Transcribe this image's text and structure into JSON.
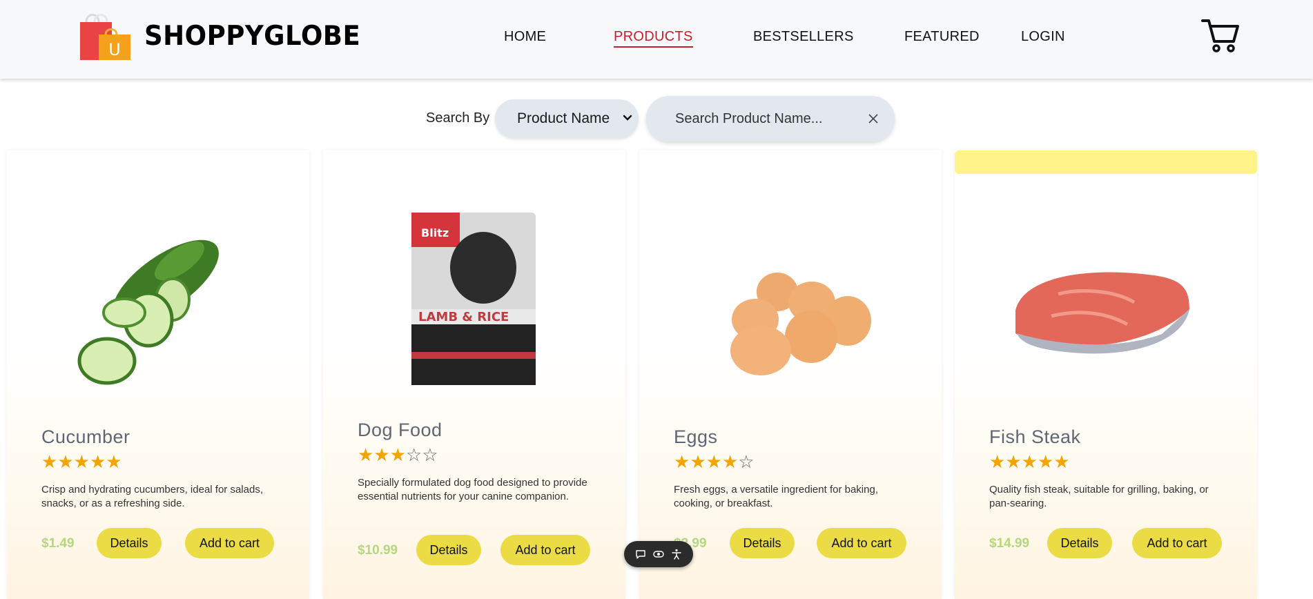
{
  "brand": {
    "name": "SHOPPYGLOBE"
  },
  "nav": {
    "items": [
      "HOME",
      "PRODUCTS",
      "BESTSELLERS",
      "FEATURED",
      "LOGIN"
    ],
    "active": "PRODUCTS"
  },
  "search": {
    "label": "Search By",
    "select_value": "Product Name",
    "placeholder": "Search Product Name..."
  },
  "products": [
    {
      "name": "Cucumber",
      "rating": 5,
      "stars": "★★★★★",
      "description": "Crisp and hydrating cucumbers, ideal for salads, snacks, or as a refreshing side.",
      "price": "$1.49"
    },
    {
      "name": "Dog Food",
      "rating": 3,
      "stars": "★★★☆☆",
      "description": "Specially formulated dog food designed to provide essential nutrients for your canine companion.",
      "price": "$10.99"
    },
    {
      "name": "Eggs",
      "rating": 4,
      "stars": "★★★★☆",
      "description": "Fresh eggs, a versatile ingredient for baking, cooking, or breakfast.",
      "price": "$2.99"
    },
    {
      "name": "Fish Steak",
      "rating": 5,
      "stars": "★★★★★",
      "description": "Quality fish steak, suitable for grilling, baking, or pan-searing.",
      "price": "$14.99"
    }
  ],
  "buttons": {
    "details": "Details",
    "add_to_cart": "Add to cart"
  },
  "colors": {
    "accent": "#c81e2c",
    "button": "#ebdc45",
    "price": "#b4d77f",
    "star": "#f2a400",
    "ribbon": "#fff38a"
  },
  "icons": [
    "shopping-bag-logo-icon",
    "cart-icon",
    "chevron-down-icon",
    "close-icon",
    "chat-icon",
    "eye-icon",
    "accessibility-icon"
  ]
}
